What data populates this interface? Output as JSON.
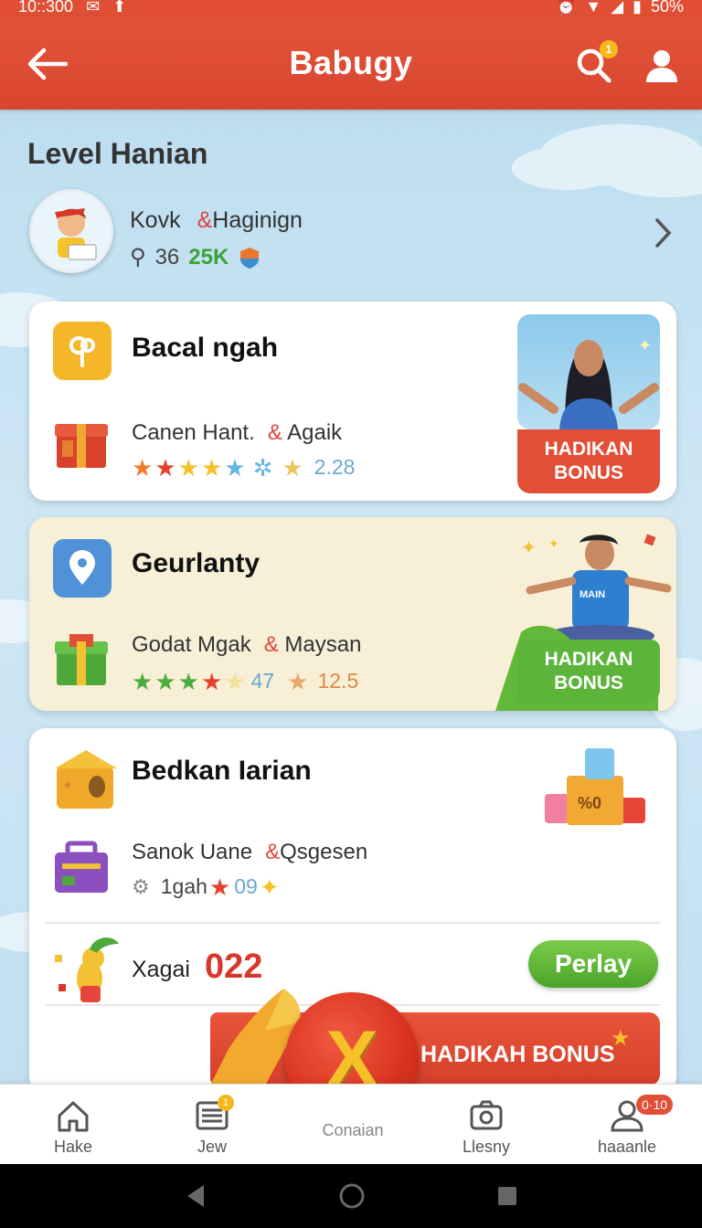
{
  "status_bar": {
    "time": "10::300",
    "battery": "50%"
  },
  "app_bar": {
    "title": "Babugy",
    "search_badge": "1"
  },
  "section": {
    "title": "Level Hanian"
  },
  "profile": {
    "name": "Kovk",
    "handle": "Haginign",
    "level": "36",
    "points": "25K"
  },
  "cards": [
    {
      "title": "Bacal ngah",
      "subtitle": "Canen Hant.",
      "partner": "Agaik",
      "score": "2.28",
      "bonus_line1": "HADIKAN",
      "bonus_line2": "BONUS"
    },
    {
      "title": "Geurlanty",
      "subtitle": "Godat Mgak",
      "partner": "Maysan",
      "score_a": "47",
      "score_b": "12.5",
      "bonus_line1": "HADIKAN",
      "bonus_line2": "BONUS"
    },
    {
      "title": "Bedkan Iarian",
      "subtitle": "Sanok Uane",
      "partner": "Qsgesen",
      "meta": "1gah",
      "score": "09"
    }
  ],
  "xagai": {
    "label": "Xagai",
    "count": "022",
    "play_label": "Perlay"
  },
  "banner": {
    "text": "HADIKAH BONUS",
    "center_glyph": "X"
  },
  "bottom_nav": {
    "items": [
      {
        "label": "Hake"
      },
      {
        "label": "Jew",
        "badge": "1"
      },
      {
        "label": "Conaian"
      },
      {
        "label": "Llesny"
      },
      {
        "label": "haaanle",
        "badge": "0·10"
      }
    ]
  },
  "colors": {
    "primary": "#e04e33",
    "accent_green": "#5cb53a",
    "accent_yellow": "#f6c028"
  }
}
